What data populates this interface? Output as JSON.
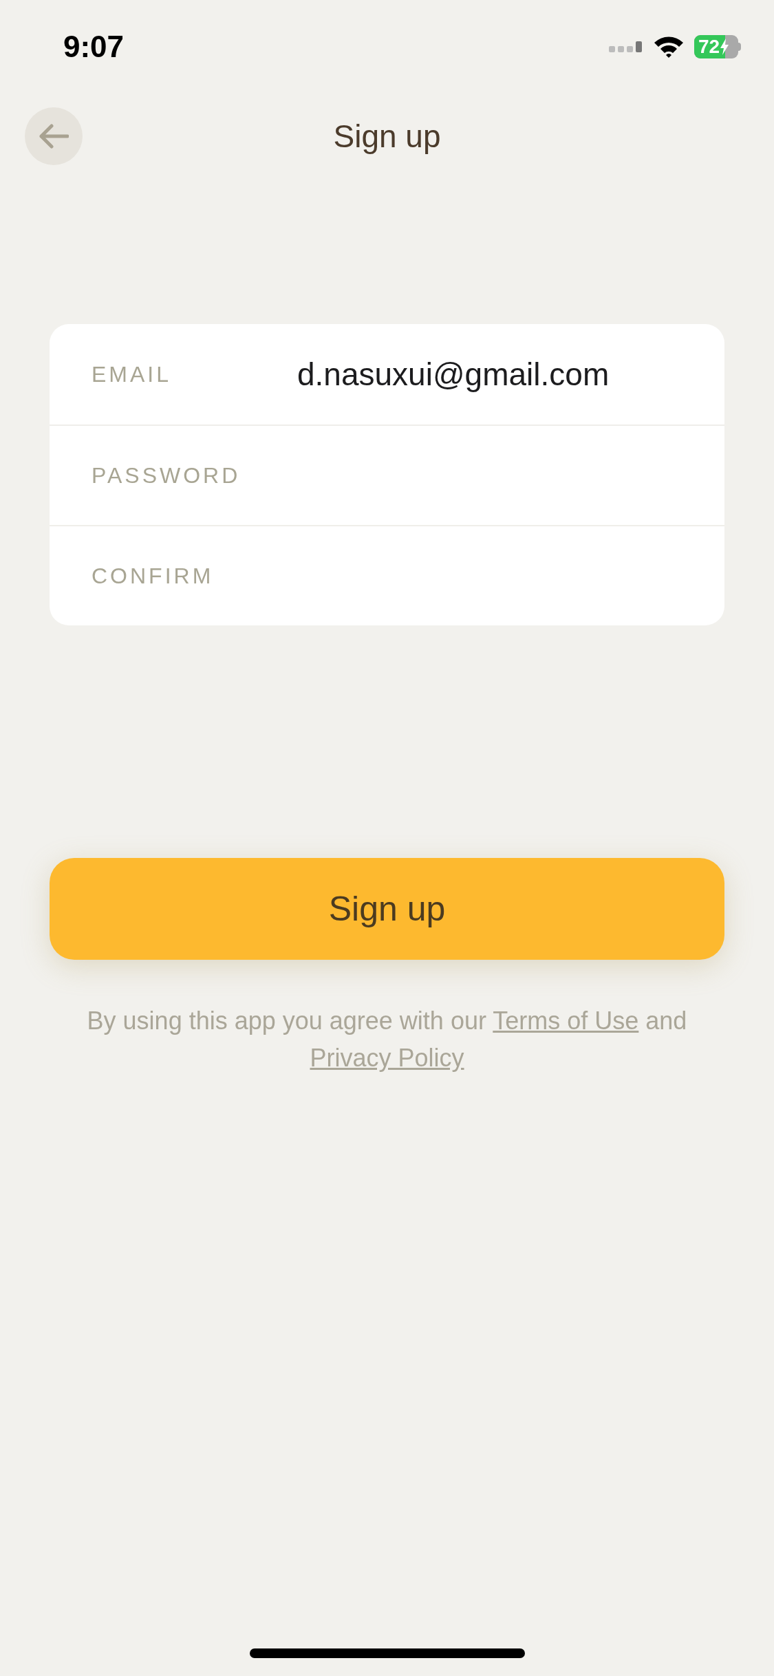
{
  "status_bar": {
    "time": "9:07",
    "battery": "72"
  },
  "nav": {
    "title": "Sign up"
  },
  "fields": [
    {
      "label": "EMAIL",
      "value": "d.nasuxui@gmail.com"
    },
    {
      "label": "PASSWORD"
    },
    {
      "label": "CONFIRM"
    }
  ],
  "submit": {
    "label": "Sign up"
  },
  "terms": {
    "before": "By using this app you agree with our",
    "link_1": "Terms of Use",
    "middle": "and",
    "link_2": "Privacy Policy"
  }
}
